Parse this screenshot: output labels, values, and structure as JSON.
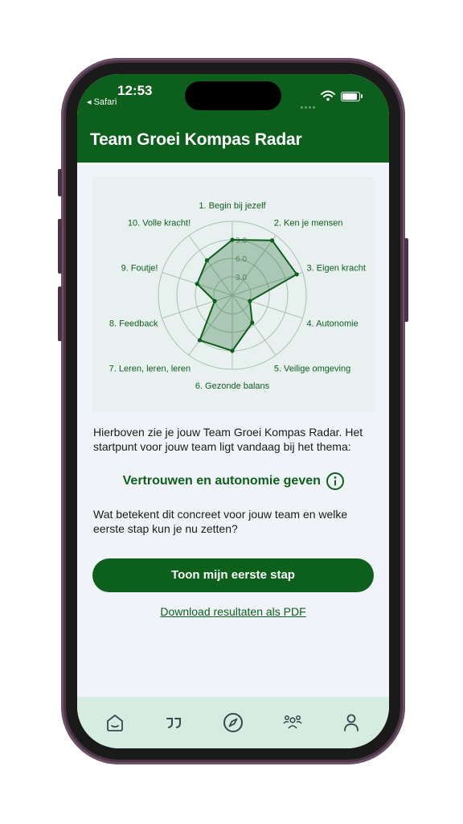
{
  "status_bar": {
    "time": "12:53",
    "back_app": "◂ Safari"
  },
  "header": {
    "title": "Team Groei Kompas Radar"
  },
  "chart_data": {
    "type": "radar",
    "axes": [
      "1. Begin bij jezelf",
      "2. Ken je mensen",
      "3. Eigen kracht",
      "4. Autonomie",
      "5. Veilige omgeving",
      "6. Gezonde balans",
      "7. Leren, leren, leren",
      "8. Feedback",
      "9. Foutje!",
      "10. Volle kracht!"
    ],
    "series": [
      {
        "values": [
          9.0,
          11.0,
          11.0,
          3.0,
          5.5,
          9.0,
          9.0,
          3.0,
          6.0,
          7.0
        ]
      }
    ],
    "tick_labels": [
      "3.0",
      "6.0",
      "9.0"
    ],
    "max": 12,
    "colors": {
      "stroke": "#0d5f1c",
      "fill": "#0d5f1c",
      "grid": "#a5c4ac"
    }
  },
  "intro_text": "Hierboven zie je jouw Team Groei Kompas Radar. Het startpunt voor jouw team ligt vandaag bij het thema:",
  "theme": {
    "label": "Vertrouwen en autonomie geven",
    "icon": "info-icon"
  },
  "question_text": "Wat betekent dit concreet voor jouw team en welke eerste stap kun je nu zetten?",
  "primary_button": "Toon mijn eerste stap",
  "pdf_link": "Download resultaten als PDF",
  "tabbar": {
    "items": [
      {
        "icon": "home-icon"
      },
      {
        "icon": "quote-icon"
      },
      {
        "icon": "compass-icon"
      },
      {
        "icon": "team-icon"
      },
      {
        "icon": "profile-icon"
      }
    ]
  }
}
